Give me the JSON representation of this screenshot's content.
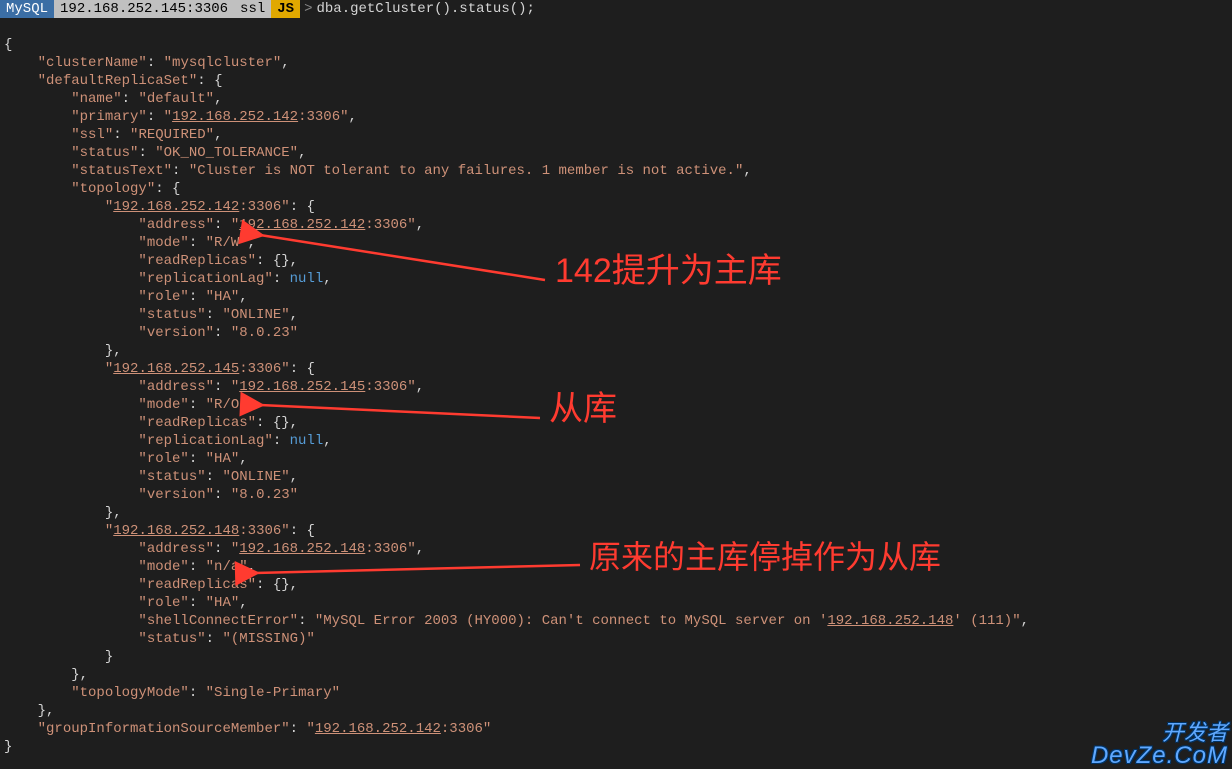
{
  "prompt": {
    "mysql": "MySQL",
    "host": "192.168.252.145:3306",
    "ssl": "ssl",
    "lang": "JS",
    "gt": ">",
    "command": "dba.getCluster().status();"
  },
  "json": {
    "clusterName_key": "\"clusterName\"",
    "clusterName_val": "\"mysqlcluster\"",
    "defaultReplicaSet_key": "\"defaultReplicaSet\"",
    "name_key": "\"name\"",
    "name_val": "\"default\"",
    "primary_key": "\"primary\"",
    "primary_val_host": "192.168.252.142",
    "primary_val_port": ":3306",
    "ssl_key": "\"ssl\"",
    "ssl_val": "\"REQUIRED\"",
    "status_key": "\"status\"",
    "status_val": "\"OK_NO_TOLERANCE\"",
    "statusText_key": "\"statusText\"",
    "statusText_val": "\"Cluster is NOT tolerant to any failures. 1 member is not active.\"",
    "topology_key": "\"topology\"",
    "node142_key_host": "192.168.252.142",
    "node142_key_port": ":3306",
    "node145_key_host": "192.168.252.145",
    "node145_key_port": ":3306",
    "node148_key_host": "192.168.252.148",
    "node148_key_port": ":3306",
    "address_key": "\"address\"",
    "address142_host": "192.168.252.142",
    "address145_host": "192.168.252.145",
    "address148_host": "192.168.252.148",
    "address_port": ":3306",
    "mode_key": "\"mode\"",
    "mode_rw": "\"R/W\"",
    "mode_ro": "\"R/O\"",
    "mode_na": "\"n/a\"",
    "readReplicas_key": "\"readReplicas\"",
    "replicationLag_key": "\"replicationLag\"",
    "null_val": "null",
    "role_key": "\"role\"",
    "role_val": "\"HA\"",
    "nodestatus_online": "\"ONLINE\"",
    "nodestatus_missing": "\"(MISSING)\"",
    "version_key": "\"version\"",
    "version_val": "\"8.0.23\"",
    "shellConnectError_key": "\"shellConnectError\"",
    "shellConnectError_pre": "\"MySQL Error 2003 (HY000): Can't connect to MySQL server on '",
    "shellConnectError_host": "192.168.252.148",
    "shellConnectError_post": "' (111)\"",
    "topologyMode_key": "\"topologyMode\"",
    "topologyMode_val": "\"Single-Primary\"",
    "gism_key": "\"groupInformationSourceMember\"",
    "gism_host": "192.168.252.142",
    "gism_port": ":3306"
  },
  "annotations": {
    "a1": "142提升为主库",
    "a2": "从库",
    "a3": "原来的主库停掉作为从库"
  },
  "watermark": {
    "line1": "开发者",
    "line2": "DevZe.CoM"
  }
}
